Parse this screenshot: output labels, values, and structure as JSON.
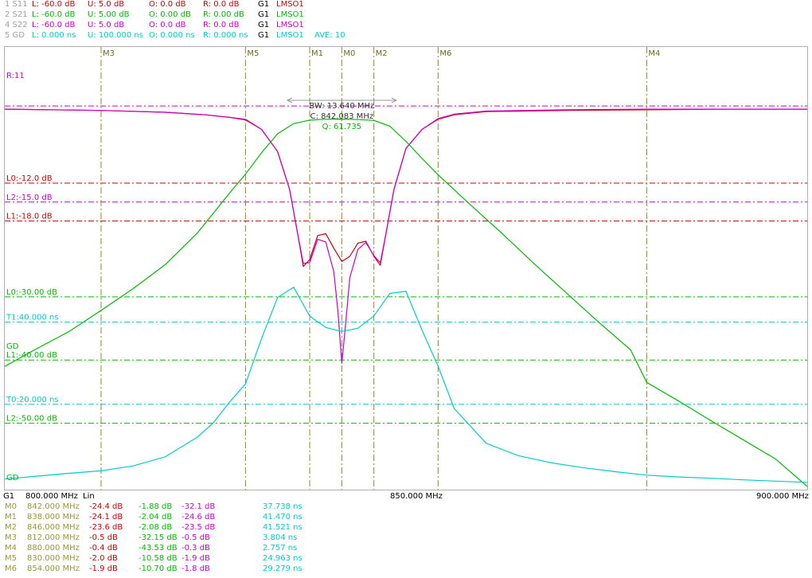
{
  "window": {
    "background": "#ffffff"
  },
  "traces": [
    {
      "id": "1 S11",
      "color": "#cc0000",
      "L": "L: -60.0 dB",
      "U": "U:  5.0 dB",
      "O": "O:  0.0 dB",
      "R": "R:  0.0 dB",
      "G": "G1",
      "mode": "LMSO1",
      "extra": ""
    },
    {
      "id": "2 S21",
      "color": "#00bb00",
      "L": "L: -60.0 dB",
      "U": "U:  5.00 dB",
      "O": "O:  0.00 dB",
      "R": "R:  0.00 dB",
      "G": "G1",
      "mode": "LMSO1",
      "extra": ""
    },
    {
      "id": "4 S22",
      "color": "#cc00cc",
      "L": "L: -60.0 dB",
      "U": "U:  5.0 dB",
      "O": "O:  0.0 dB",
      "R": "R:  0.0 dB",
      "G": "G1",
      "mode": "LMSO1",
      "extra": ""
    },
    {
      "id": "5 GD",
      "color": "#00cccc",
      "L": "L:  0.000 ns",
      "U": "U: 100.000 ns",
      "O": "O:  0.000 ns",
      "R": "R:  0.000 ns",
      "G": "G1",
      "mode": "LMSO1",
      "extra": "AVE:  10"
    }
  ],
  "plot": {
    "reference_labels": [
      {
        "text": "R:11",
        "color": "#cc00cc"
      },
      {
        "text": "GD",
        "color": "#00bb00"
      },
      {
        "text": "GD",
        "color": "#00bb00"
      }
    ],
    "limit_lines": [
      {
        "label": "L0:-12.0 dB",
        "color": "#cc0000",
        "value": -12.0,
        "unit": "dB"
      },
      {
        "label": "L2:-15.0 dB",
        "color": "#cc00cc",
        "value": -15.0,
        "unit": "dB"
      },
      {
        "label": "L1:-18.0 dB",
        "color": "#cc0000",
        "value": -18.0,
        "unit": "dB"
      },
      {
        "label": "L0:-30.00 dB",
        "color": "#00bb00",
        "value": -30.0,
        "unit": "dB"
      },
      {
        "label": "T1:40.000 ns",
        "color": "#00cccc",
        "value": 40.0,
        "unit": "ns"
      },
      {
        "label": "L1:-40.00 dB",
        "color": "#00bb00",
        "value": -40.0,
        "unit": "dB"
      },
      {
        "label": "T0:20.000 ns",
        "color": "#00cccc",
        "value": 20.0,
        "unit": "ns"
      },
      {
        "label": "L2:-50.00 dB",
        "color": "#00bb00",
        "value": -50.0,
        "unit": "dB"
      }
    ],
    "bandwidth": {
      "bw": "BW:  13.640 MHz",
      "center": "C: 842.083 MHz",
      "q": "Q: 61.735",
      "color": "#00bb00"
    }
  },
  "x_axis": {
    "channel": "G1",
    "start": "800.000 MHz",
    "scale": "Lin",
    "mid": "850.000 MHz",
    "stop": "900.000 MHz"
  },
  "markers": [
    {
      "name": "M0",
      "color": "#999933",
      "freq": "842.000 MHz",
      "s11": "-24.4 dB",
      "s21": "-1.88 dB",
      "s22": "-32.1 dB",
      "gd": "37.738 ns"
    },
    {
      "name": "M1",
      "color": "#999933",
      "freq": "838.000 MHz",
      "s11": "-24.1 dB",
      "s21": "-2.04 dB",
      "s22": "-24.6 dB",
      "gd": "41.470 ns"
    },
    {
      "name": "M2",
      "color": "#999933",
      "freq": "846.000 MHz",
      "s11": "-23.6 dB",
      "s21": "-2.08 dB",
      "s22": "-23.5 dB",
      "gd": "41.521 ns"
    },
    {
      "name": "M3",
      "color": "#999933",
      "freq": "812.000 MHz",
      "s11": "-0.5 dB",
      "s21": "-32.15 dB",
      "s22": "-0.5 dB",
      "gd": "3.804 ns"
    },
    {
      "name": "M4",
      "color": "#999933",
      "freq": "880.000 MHz",
      "s11": "-0.4 dB",
      "s21": "-43.53 dB",
      "s22": "-0.3 dB",
      "gd": "2.757 ns"
    },
    {
      "name": "M5",
      "color": "#999933",
      "freq": "830.000 MHz",
      "s11": "-2.0 dB",
      "s21": "-10.58 dB",
      "s22": "-1.9 dB",
      "gd": "24.963 ns"
    },
    {
      "name": "M6",
      "color": "#999933",
      "freq": "854.000 MHz",
      "s11": "-1.9 dB",
      "s21": "-10.70 dB",
      "s22": "-1.8 dB",
      "gd": "29.279 ns"
    }
  ],
  "chart_data": {
    "type": "line",
    "x_range_mhz": [
      800,
      900
    ],
    "db_range": [
      -60,
      5
    ],
    "gd_range_ns": [
      0,
      100
    ],
    "grid": false,
    "series": [
      {
        "name": "1 S11",
        "color": "#cc0000",
        "unit": "dB",
        "x": [
          800,
          812,
          820,
          825,
          828,
          830,
          832,
          834,
          835.5,
          836.5,
          837.2,
          838,
          839,
          840,
          841,
          842,
          843,
          844,
          845,
          846,
          846.8,
          847.5,
          848.5,
          850,
          852,
          854,
          856,
          860,
          870,
          880,
          890,
          900
        ],
        "y": [
          -0.3,
          -0.5,
          -0.8,
          -1.2,
          -1.6,
          -2.0,
          -3.5,
          -7,
          -13,
          -20,
          -25.2,
          -24.1,
          -20.3,
          -20.0,
          -22.3,
          -24.4,
          -23.6,
          -21.5,
          -21.2,
          -23.6,
          -25.0,
          -20,
          -13,
          -6.5,
          -3.5,
          -1.9,
          -1.2,
          -0.7,
          -0.5,
          -0.4,
          -0.3,
          -0.3
        ]
      },
      {
        "name": "4 S22",
        "color": "#cc00cc",
        "unit": "dB",
        "x": [
          800,
          812,
          820,
          825,
          828,
          830,
          832,
          834,
          835.5,
          836.5,
          837.2,
          838,
          839,
          840,
          841,
          841.5,
          842,
          842.5,
          843,
          844,
          845,
          846,
          846.8,
          847.5,
          848.5,
          850,
          852,
          854,
          856,
          860,
          870,
          880,
          890,
          900
        ],
        "y": [
          -0.3,
          -0.5,
          -0.8,
          -1.2,
          -1.6,
          -1.9,
          -3.5,
          -7,
          -13,
          -20,
          -24.7,
          -24.6,
          -20.9,
          -21.3,
          -26,
          -32,
          -40.5,
          -34,
          -27,
          -22.5,
          -21.4,
          -23.5,
          -24.6,
          -20,
          -13,
          -6.5,
          -3.5,
          -1.8,
          -1.1,
          -0.6,
          -0.4,
          -0.3,
          -0.3,
          -0.3
        ]
      },
      {
        "name": "2 S21",
        "color": "#00bb00",
        "unit": "dB",
        "x": [
          800,
          804,
          808,
          812,
          816,
          820,
          824,
          828,
          830,
          832,
          834,
          836,
          838,
          840,
          842,
          844,
          846,
          848,
          850,
          852,
          854,
          858,
          862,
          866,
          870,
          874,
          878,
          880,
          884,
          888,
          892,
          896,
          900
        ],
        "y": [
          -41,
          -38.2,
          -35.5,
          -32.15,
          -28.7,
          -24.9,
          -19.9,
          -13.6,
          -10.58,
          -7.2,
          -4.2,
          -2.6,
          -2.04,
          -1.9,
          -1.88,
          -1.95,
          -2.08,
          -3.0,
          -5.4,
          -8.1,
          -10.7,
          -15.4,
          -20.0,
          -24.8,
          -29.4,
          -34.0,
          -38.4,
          -43.53,
          -46.5,
          -49.6,
          -52.6,
          -55.6,
          -60
        ]
      },
      {
        "name": "5 GD",
        "color": "#00cccc",
        "unit": "ns",
        "x": [
          800,
          804,
          808,
          812,
          816,
          820,
          824,
          826,
          828,
          830,
          832,
          834,
          836,
          838,
          840,
          842,
          844,
          846,
          848,
          850,
          852,
          854,
          856,
          860,
          864,
          868,
          872,
          876,
          880,
          884,
          888,
          892,
          896,
          900
        ],
        "y": [
          1.8,
          2.5,
          3.2,
          3.804,
          5.0,
          7.2,
          12.0,
          15.5,
          20.5,
          24.963,
          36.0,
          46.0,
          48.5,
          41.47,
          38.7,
          37.738,
          38.5,
          41.521,
          47.0,
          47.5,
          38.0,
          29.279,
          19.0,
          10.5,
          7.5,
          5.8,
          4.6,
          3.6,
          2.757,
          2.3,
          2.0,
          1.6,
          1.3,
          1.0
        ]
      }
    ],
    "markers": [
      {
        "name": "M0",
        "x": 842
      },
      {
        "name": "M1",
        "x": 838
      },
      {
        "name": "M2",
        "x": 846
      },
      {
        "name": "M3",
        "x": 812
      },
      {
        "name": "M4",
        "x": 880
      },
      {
        "name": "M5",
        "x": 830
      },
      {
        "name": "M6",
        "x": 854
      }
    ],
    "bandwidth_bar_mhz": [
      835.2,
      848.8
    ]
  }
}
